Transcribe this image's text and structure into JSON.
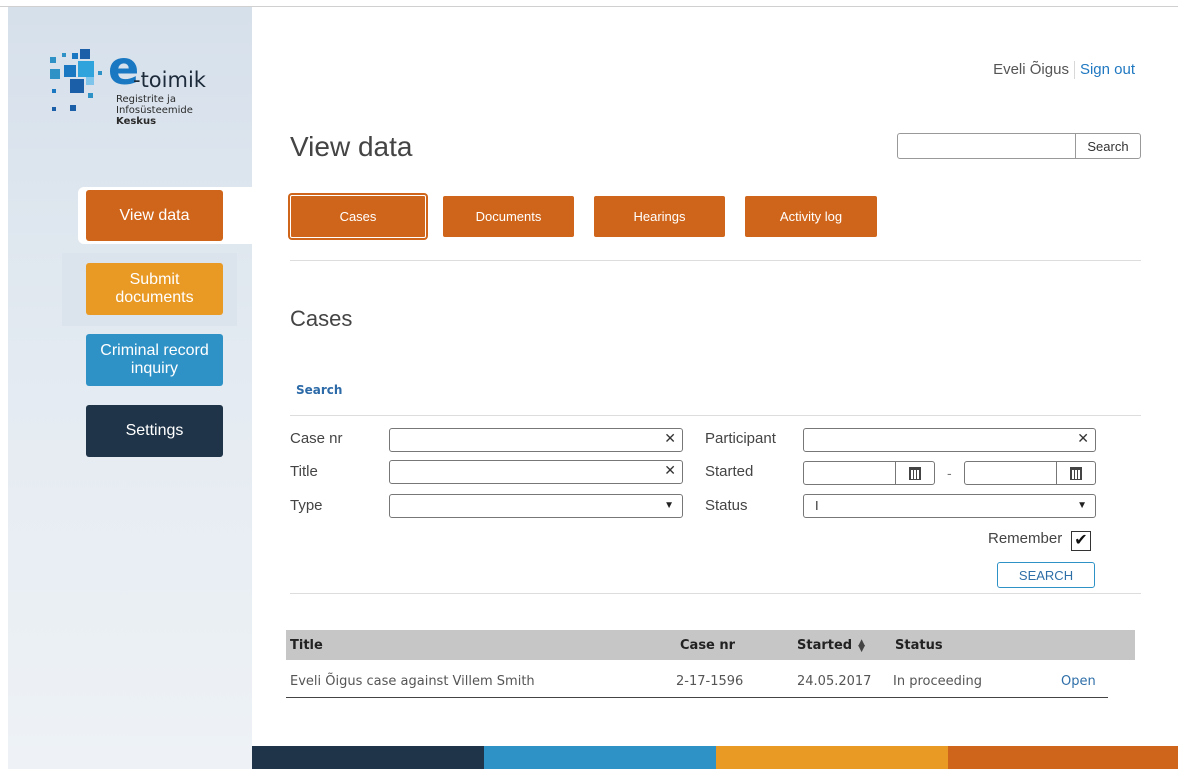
{
  "logo": {
    "brand_e": "e",
    "brand_rest": "-toimik",
    "org_line1": "Registrite ja",
    "org_line2": "Infosüsteemide",
    "org_line3": "Keskus"
  },
  "sidebar": {
    "items": [
      {
        "label": "View data",
        "color": "#cf651a",
        "active": true
      },
      {
        "label": "Submit documents",
        "color": "#e89a25"
      },
      {
        "label": "Criminal record inquiry",
        "color": "#2f92c6"
      },
      {
        "label": "Settings",
        "color": "#1f3448"
      }
    ]
  },
  "header": {
    "user_name": "Eveli Õigus",
    "sign_out": "Sign out",
    "page_title": "View data",
    "search_button": "Search"
  },
  "tabs": [
    {
      "label": "Cases",
      "active": true
    },
    {
      "label": "Documents"
    },
    {
      "label": "Hearings"
    },
    {
      "label": "Activity log"
    }
  ],
  "cases": {
    "section_title": "Cases",
    "search_toggle": "Search",
    "filters": {
      "case_nr_label": "Case nr",
      "title_label": "Title",
      "type_label": "Type",
      "participant_label": "Participant",
      "started_label": "Started",
      "status_label": "Status",
      "status_value": "I",
      "range_separator": "-",
      "remember_label": "Remember",
      "remember_checked": true,
      "search_button": "SEARCH"
    },
    "table": {
      "columns": [
        "Title",
        "Case nr",
        "Started",
        "Status"
      ],
      "rows": [
        {
          "title": "Eveli Õigus case against Villem Smith",
          "case_nr": "2-17-1596",
          "started": "24.05.2017",
          "status": "In proceeding",
          "action": "Open"
        }
      ]
    }
  },
  "footer_colors": [
    "#1f3448",
    "#2f92c6",
    "#e89a25",
    "#cf651a"
  ]
}
